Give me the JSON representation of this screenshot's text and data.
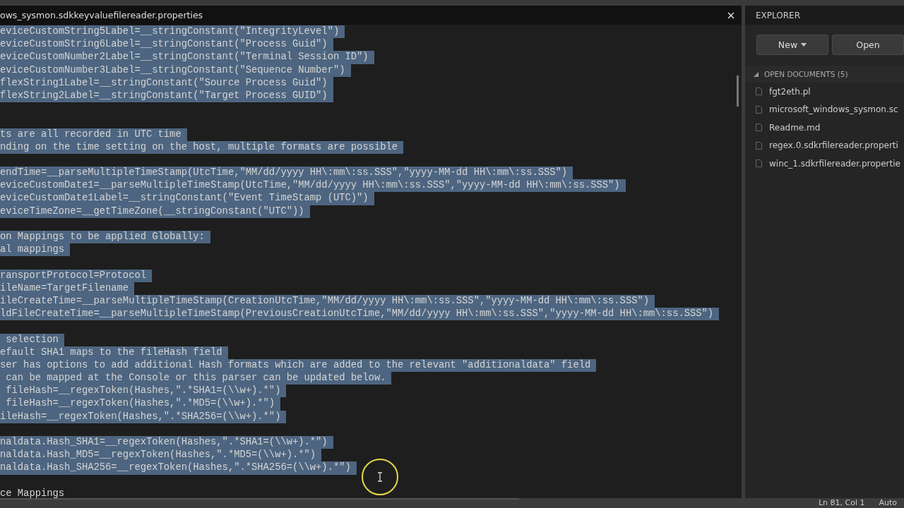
{
  "editor": {
    "tab_title": "ows_sysmon.sdkkeyvaluefilereader.properties",
    "lines": [
      {
        "kind": "code",
        "text": "eviceCustomString5Label=__stringConstant(\"IntegrityLevel\")",
        "selected": true
      },
      {
        "kind": "code",
        "text": "eviceCustomString6Label=__stringConstant(\"Process Guid\")",
        "selected": true
      },
      {
        "kind": "code",
        "text": "eviceCustomNumber2Label=__stringConstant(\"Terminal Session ID\")",
        "selected": true
      },
      {
        "kind": "code",
        "text": "eviceCustomNumber3Label=__stringConstant(\"Sequence Number\")",
        "selected": true
      },
      {
        "kind": "code",
        "text": "flexString1Label=__stringConstant(\"Source Process Guid\")",
        "selected": true
      },
      {
        "kind": "code",
        "text": "flexString2Label=__stringConstant(\"Target Process GUID\")",
        "selected": true
      },
      {
        "kind": "blank"
      },
      {
        "kind": "blank"
      },
      {
        "kind": "code",
        "text": "ts are all recorded in UTC time",
        "selected": true
      },
      {
        "kind": "code",
        "text": "nding on the time setting on the host, multiple formats are possible",
        "selected": true
      },
      {
        "kind": "blank"
      },
      {
        "kind": "code",
        "text": "endTime=__parseMultipleTimeStamp(UtcTime,\"MM/dd/yyyy HH\\:mm\\:ss.SSS\",\"yyyy-MM-dd HH\\:mm\\:ss.SSS\")",
        "selected": true
      },
      {
        "kind": "code",
        "text": "eviceCustomDate1=__parseMultipleTimeStamp(UtcTime,\"MM/dd/yyyy HH\\:mm\\:ss.SSS\",\"yyyy-MM-dd HH\\:mm\\:ss.SSS\")",
        "selected": true
      },
      {
        "kind": "code",
        "text": "eviceCustomDate1Label=__stringConstant(\"Event TimeStamp (UTC)\")",
        "selected": true
      },
      {
        "kind": "code",
        "text": "eviceTimeZone=__getTimeZone(__stringConstant(\"UTC\"))",
        "selected": true
      },
      {
        "kind": "blank"
      },
      {
        "kind": "code",
        "text": "on Mappings to be applied Globally:",
        "selected": true
      },
      {
        "kind": "code",
        "text": "al mappings",
        "selected": true
      },
      {
        "kind": "blank"
      },
      {
        "kind": "code",
        "text": "ransportProtocol=Protocol",
        "selected": true
      },
      {
        "kind": "code",
        "text": "ileName=TargetFilename",
        "selected": true
      },
      {
        "kind": "code",
        "text": "ileCreateTime=__parseMultipleTimeStamp(CreationUtcTime,\"MM/dd/yyyy HH\\:mm\\:ss.SSS\",\"yyyy-MM-dd HH\\:mm\\:ss.SSS\")",
        "selected": true
      },
      {
        "kind": "code",
        "text": "ldFileCreateTime=__parseMultipleTimeStamp(PreviousCreationUtcTime,\"MM/dd/yyyy HH\\:mm\\:ss.SSS\",\"yyyy-MM-dd HH\\:mm\\:ss.SSS\")",
        "selected": true
      },
      {
        "kind": "blank"
      },
      {
        "kind": "code",
        "text": " selection",
        "selected": true
      },
      {
        "kind": "code",
        "text": "efault SHA1 maps to the fileHash field",
        "selected": true
      },
      {
        "kind": "code",
        "text": "ser has options to add additional Hash formats which are added to the relevant \"additionaldata\" field",
        "selected": true
      },
      {
        "kind": "code",
        "text": " can be mapped at the Console or this parser can be updated below.",
        "selected": true
      },
      {
        "kind": "code",
        "text": " fileHash=__regexToken(Hashes,\".*SHA1=(\\\\w+).*\")",
        "selected": true
      },
      {
        "kind": "code",
        "text": " fileHash=__regexToken(Hashes,\".*MD5=(\\\\w+).*\")",
        "selected": true
      },
      {
        "kind": "code",
        "text": "ileHash=__regexToken(Hashes,\".*SHA256=(\\\\w+).*\")",
        "selected": true
      },
      {
        "kind": "blank"
      },
      {
        "kind": "code",
        "text": "naldata.Hash_SHA1=__regexToken(Hashes,\".*SHA1=(\\\\w+).*\")",
        "selected": true
      },
      {
        "kind": "code",
        "text": "naldata.Hash_MD5=__regexToken(Hashes,\".*MD5=(\\\\w+).*\")",
        "selected": true
      },
      {
        "kind": "code",
        "text": "naldata.Hash_SHA256=__regexToken(Hashes,\".*SHA256=(\\\\w+).*\")",
        "selected": true
      },
      {
        "kind": "blank"
      },
      {
        "kind": "code",
        "text": "ce Mappings",
        "selected": false
      }
    ]
  },
  "explorer": {
    "title": "EXPLORER",
    "buttons": [
      {
        "label": "New",
        "dropdown": true
      },
      {
        "label": "Open",
        "dropdown": false
      }
    ],
    "section": {
      "title": "OPEN DOCUMENTS (5)",
      "expanded": true,
      "items": [
        {
          "name": "fgt2eth.pl"
        },
        {
          "name": "microsoft_windows_sysmon.sc"
        },
        {
          "name": "Readme.md"
        },
        {
          "name": "regex.0.sdkrfilereader.properti"
        },
        {
          "name": "winc_1.sdkrfilereader.propertie"
        }
      ]
    }
  },
  "status_bar": {
    "position": "Ln 81, Col 1",
    "mode": "Auto"
  }
}
